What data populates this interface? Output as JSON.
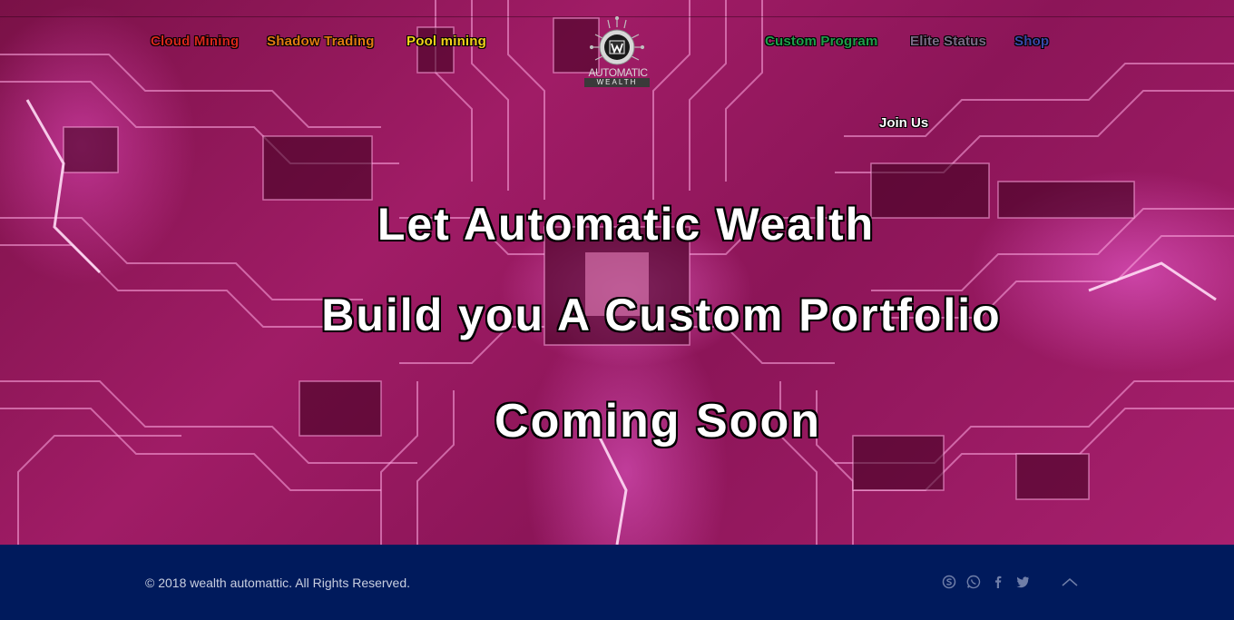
{
  "nav": {
    "left": [
      {
        "label": "Cloud Mining",
        "color": "#d9261c"
      },
      {
        "label": "Shadow Trading",
        "color": "#e07b12"
      },
      {
        "label": "Pool mining",
        "color": "#f2d21b"
      }
    ],
    "right": [
      {
        "label": "Custom Program",
        "color": "#1f9e4a"
      },
      {
        "label": "Elite Status",
        "color": "#7a6a86"
      },
      {
        "label": "Shop",
        "color": "#3a49a8"
      }
    ],
    "join": "Join Us"
  },
  "logo": {
    "line1": "AUTOMATIC",
    "line2": "WEALTH",
    "icon": "w-chip-logo-icon"
  },
  "hero": {
    "line1": "Let Automatic Wealth",
    "line2": "Build you A Custom Portfolio",
    "line3": "Coming Soon"
  },
  "footer": {
    "copyright": "© 2018 wealth automattic. All Rights Reserved.",
    "icons": [
      "skype-icon",
      "whatsapp-icon",
      "facebook-icon",
      "twitter-icon",
      "scroll-up-icon"
    ]
  },
  "colors": {
    "hero_pink": "#a01c66",
    "footer_bg": "#001a5c"
  }
}
